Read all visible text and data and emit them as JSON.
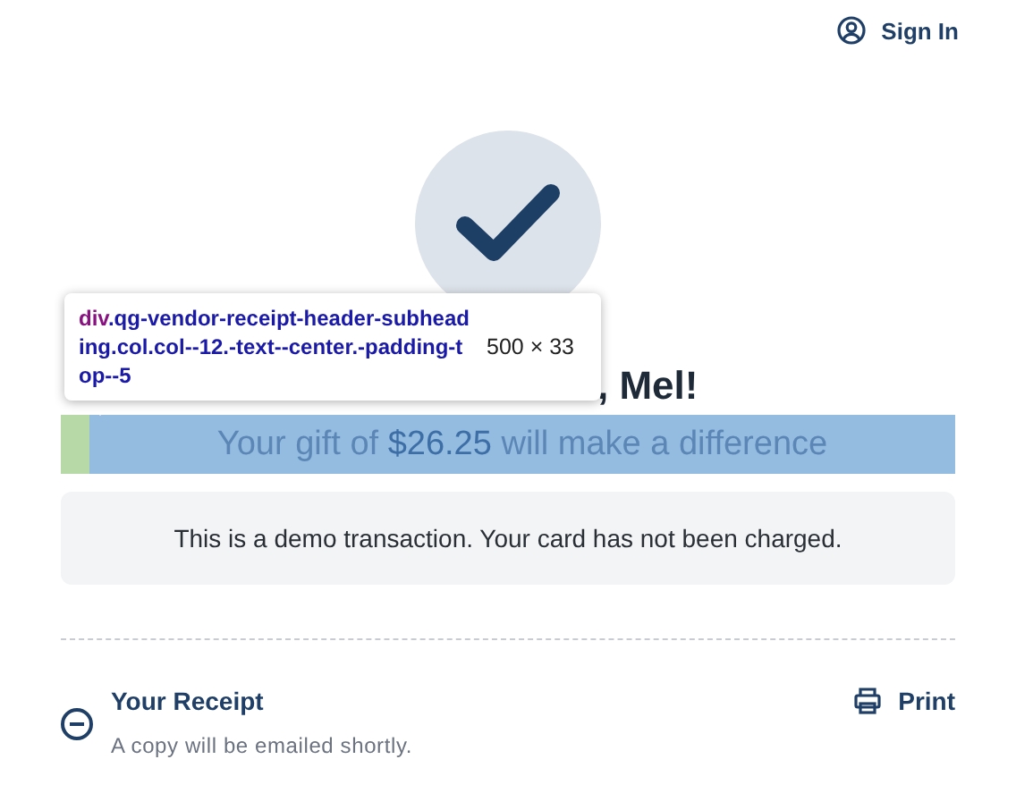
{
  "header": {
    "sign_in": "Sign In"
  },
  "tooltip": {
    "tag": "div",
    "selector": ".qg-vendor-receipt-header-subheading.col.col--12.-text--center.-padding-top--5",
    "size": "500 × 33"
  },
  "heading": ", Mel!",
  "subheading": "Your gift of **$26.25** will make a difference",
  "notice": "This is a demo transaction. Your card has not been charged.",
  "receipt": {
    "title": "Your Receipt",
    "note": "A copy will be emailed shortly.",
    "expanded": true,
    "print": "Print"
  }
}
